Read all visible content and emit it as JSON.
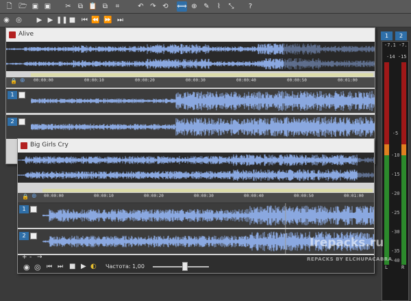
{
  "colors": {
    "wave": "#8aa8e0",
    "wave_dark": "#6483bc",
    "accent": "#2f6fa8",
    "meter_green": "#2c8a2c",
    "meter_orange": "#e08020",
    "meter_red": "#a01818"
  },
  "toolbar1": {
    "buttons": [
      {
        "name": "new-file-icon",
        "glyph": "🗋"
      },
      {
        "name": "open-icon",
        "glyph": "🗁"
      },
      {
        "name": "save-icon",
        "glyph": "▣"
      },
      {
        "name": "save-as-icon",
        "glyph": "▣"
      },
      {
        "name": "cut-icon",
        "glyph": "✂"
      },
      {
        "name": "copy-icon",
        "glyph": "⧉"
      },
      {
        "name": "paste-icon",
        "glyph": "📋"
      },
      {
        "name": "paste-mix-icon",
        "glyph": "⧉"
      },
      {
        "name": "crop-icon",
        "glyph": "⌗"
      },
      {
        "name": "undo-icon",
        "glyph": "↶"
      },
      {
        "name": "redo-icon",
        "glyph": "↷"
      },
      {
        "name": "repeat-icon",
        "glyph": "⟲"
      },
      {
        "name": "edit-tool-icon",
        "glyph": "⟺"
      },
      {
        "name": "magnify-tool-icon",
        "glyph": "⊕"
      },
      {
        "name": "pencil-tool-icon",
        "glyph": "✎"
      },
      {
        "name": "envelope-tool-icon",
        "glyph": "⌇"
      },
      {
        "name": "cursor-tool-icon",
        "glyph": "⤡"
      },
      {
        "name": "help-icon",
        "glyph": "?"
      }
    ]
  },
  "toolbar2": {
    "buttons": [
      {
        "name": "record-icon",
        "glyph": "◉"
      },
      {
        "name": "loop-icon",
        "glyph": "◎"
      },
      {
        "name": "play-from-start-icon",
        "glyph": "▶"
      },
      {
        "name": "play-icon",
        "glyph": "▶"
      },
      {
        "name": "pause-icon",
        "glyph": "❚❚"
      },
      {
        "name": "stop-icon",
        "glyph": "■"
      },
      {
        "name": "go-to-start-icon",
        "glyph": "⏮"
      },
      {
        "name": "rewind-icon",
        "glyph": "⏪"
      },
      {
        "name": "fast-forward-icon",
        "glyph": "⏩"
      },
      {
        "name": "go-to-end-icon",
        "glyph": "⏭"
      }
    ]
  },
  "window1": {
    "title": "Alive",
    "ruler_ticks": [
      "00:00:00",
      "00:00:10",
      "00:00:20",
      "00:00:30",
      "00:00:40",
      "00:00:50",
      "00:01:00"
    ],
    "tracks": [
      {
        "label": "1"
      },
      {
        "label": "2"
      }
    ]
  },
  "window2": {
    "title": "Big Girls Cry",
    "ruler_ticks": [
      "00:00:00",
      "00:00:10",
      "00:00:20",
      "00:00:30",
      "00:00:40",
      "00:00:50",
      "00:01:00"
    ],
    "tracks": [
      {
        "label": "1"
      },
      {
        "label": "2"
      }
    ],
    "rate_label": "Частота: 1,00",
    "zoom_plus": "+",
    "zoom_minus": "-"
  },
  "meter": {
    "nav_left": "1",
    "nav_right": "2",
    "peak_text": "-7.1 -7.",
    "level_text": "-14 -15",
    "scale": [
      "-5",
      "-10",
      "-15",
      "-20",
      "-25",
      "-30",
      "-35",
      "-40"
    ],
    "channel_l": "L",
    "channel_r": "R"
  },
  "watermark": {
    "main": "Irepacks.ru",
    "sub": "REPACKS BY ELCHUPACABRA"
  }
}
